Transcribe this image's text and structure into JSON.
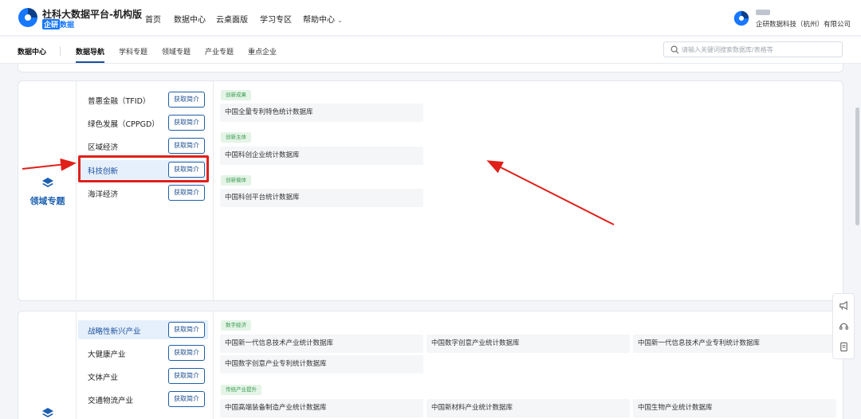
{
  "header": {
    "title": "社科大数据平台-机构版",
    "sub_badge": "企研",
    "sub_text": "数据",
    "nav": [
      "首页",
      "数据中心",
      "云桌面版",
      "学习专区",
      "帮助中心"
    ],
    "company": "企研数据科技（杭州）有限公司"
  },
  "subnav": {
    "home": "数据中心",
    "items": [
      "数据导航",
      "学科专题",
      "领域专题",
      "产业专题",
      "重点企业"
    ],
    "active_index": 0,
    "search_placeholder": "请输入关键词搜索数据库/表格等"
  },
  "domain_card": {
    "side_label": "领域专题",
    "button_label": "获取简介",
    "items": [
      "普惠金融（TFID）",
      "绿色发展（CPPGD）",
      "区域经济",
      "科技创新",
      "海洋经济"
    ],
    "active_index": 3,
    "groups": [
      {
        "tag": "创新成果",
        "databases": [
          "中国全量专利特色统计数据库"
        ]
      },
      {
        "tag": "创新主体",
        "databases": [
          "中国科创企业统计数据库"
        ]
      },
      {
        "tag": "创新载体",
        "databases": [
          "中国科创平台统计数据库"
        ]
      }
    ]
  },
  "industry_card": {
    "button_label": "获取简介",
    "items": [
      "战略性新兴产业",
      "大健康产业",
      "文体产业",
      "交通物流产业"
    ],
    "active_index": 0,
    "groups": [
      {
        "tag": "数字经济",
        "databases": [
          "中国新一代信息技术产业统计数据库",
          "中国数字创意产业统计数据库",
          "中国新一代信息技术产业专利统计数据库",
          "中国数字创意产业专利统计数据库"
        ]
      },
      {
        "tag": "传统产业提升",
        "databases": [
          "中国高端装备制造产业统计数据库",
          "中国新材料产业统计数据库",
          "中国生物产业统计数据库"
        ]
      }
    ]
  },
  "colors": {
    "brand": "#1b4f9c",
    "accent_blue": "#1677ff",
    "annotation_red": "#e0201b",
    "tag_green": "#3a9a52"
  },
  "icons": [
    "logo-icon",
    "chevron-down-icon",
    "search-icon",
    "layers-icon",
    "megaphone-icon",
    "headset-icon",
    "document-icon"
  ]
}
